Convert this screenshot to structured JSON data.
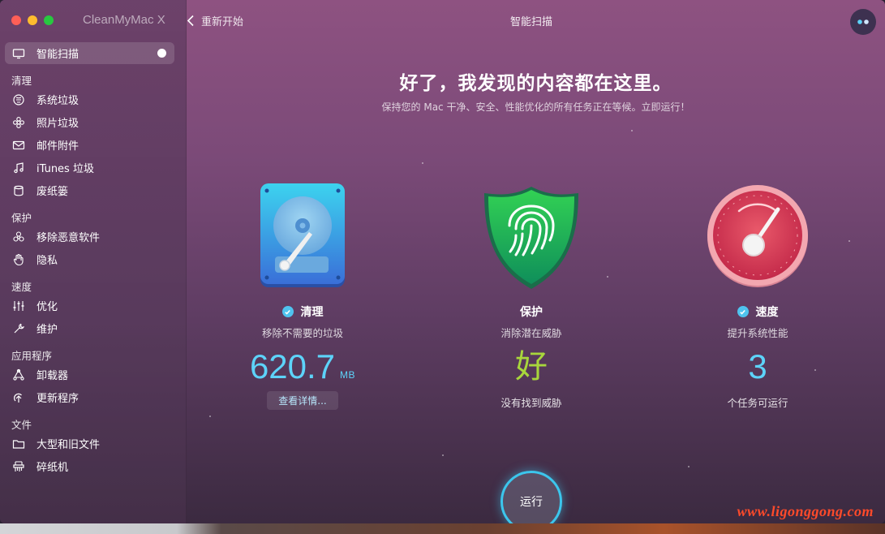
{
  "app": {
    "title": "CleanMyMac X"
  },
  "toolbar": {
    "back_label": "重新开始",
    "page_title": "智能扫描"
  },
  "sidebar": {
    "active": {
      "label": "智能扫描",
      "icon": "monitor-icon"
    },
    "sections": [
      {
        "title": "清理",
        "items": [
          {
            "label": "系统垃圾",
            "icon": "system-junk-icon"
          },
          {
            "label": "照片垃圾",
            "icon": "flower-icon"
          },
          {
            "label": "邮件附件",
            "icon": "mail-icon"
          },
          {
            "label": "iTunes 垃圾",
            "icon": "music-note-icon"
          },
          {
            "label": "废纸篓",
            "icon": "trash-icon"
          }
        ]
      },
      {
        "title": "保护",
        "items": [
          {
            "label": "移除恶意软件",
            "icon": "biohazard-icon"
          },
          {
            "label": "隐私",
            "icon": "hand-icon"
          }
        ]
      },
      {
        "title": "速度",
        "items": [
          {
            "label": "优化",
            "icon": "sliders-icon"
          },
          {
            "label": "维护",
            "icon": "wrench-icon"
          }
        ]
      },
      {
        "title": "应用程序",
        "items": [
          {
            "label": "卸载器",
            "icon": "uninstaller-icon"
          },
          {
            "label": "更新程序",
            "icon": "updater-icon"
          }
        ]
      },
      {
        "title": "文件",
        "items": [
          {
            "label": "大型和旧文件",
            "icon": "folder-icon"
          },
          {
            "label": "碎纸机",
            "icon": "shredder-icon"
          }
        ]
      }
    ]
  },
  "main": {
    "headline": "好了，我发现的内容都在这里。",
    "subline": "保持您的 Mac 干净、安全、性能优化的所有任务正在等候。立即运行！",
    "cards": {
      "cleanup": {
        "title": "清理",
        "subtitle": "移除不需要的垃圾",
        "value": "620.7",
        "unit": "MB",
        "button": "查看详情..."
      },
      "protection": {
        "title": "保护",
        "subtitle": "消除潜在威胁",
        "value": "好",
        "footer": "没有找到威胁"
      },
      "speed": {
        "title": "速度",
        "subtitle": "提升系统性能",
        "value": "3",
        "footer": "个任务可运行"
      }
    },
    "run_button": "运行"
  },
  "watermark": "www.ligonggong.com",
  "colors": {
    "accent": "#5dd3f9",
    "good": "#a8d63c",
    "check": "#4fc3ef",
    "ring": "#3cc6ec"
  }
}
